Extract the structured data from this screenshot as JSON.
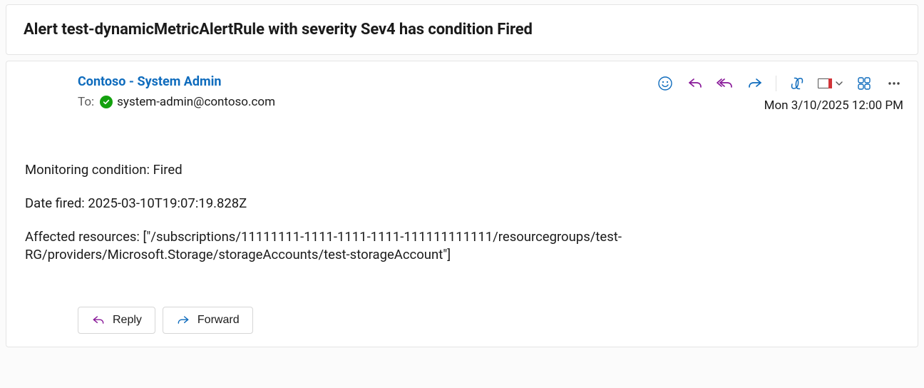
{
  "subject": "Alert test-dynamicMetricAlertRule with severity Sev4 has condition Fired",
  "sender": {
    "name": "Contoso - System Admin",
    "to_label": "To:",
    "to_email": "system-admin@contoso.com"
  },
  "datetime": "Mon 3/10/2025 12:00 PM",
  "toolbar": {
    "smiley": "smiley-icon",
    "reply": "reply-icon",
    "reply_all": "reply-all-icon",
    "forward": "forward-icon",
    "copilot": "copilot-icon",
    "flag": "flag-icon",
    "apps": "apps-icon",
    "more": "more-icon"
  },
  "body": {
    "line1": "Monitoring condition: Fired",
    "line2": "Date fired: 2025-03-10T19:07:19.828Z",
    "line3": "Affected resources: [\"/subscriptions/11111111-1111-1111-1111-111111111111/resourcegroups/test-RG/providers/Microsoft.Storage/storageAccounts/test-storageAccount\"]"
  },
  "buttons": {
    "reply": "Reply",
    "forward": "Forward"
  }
}
